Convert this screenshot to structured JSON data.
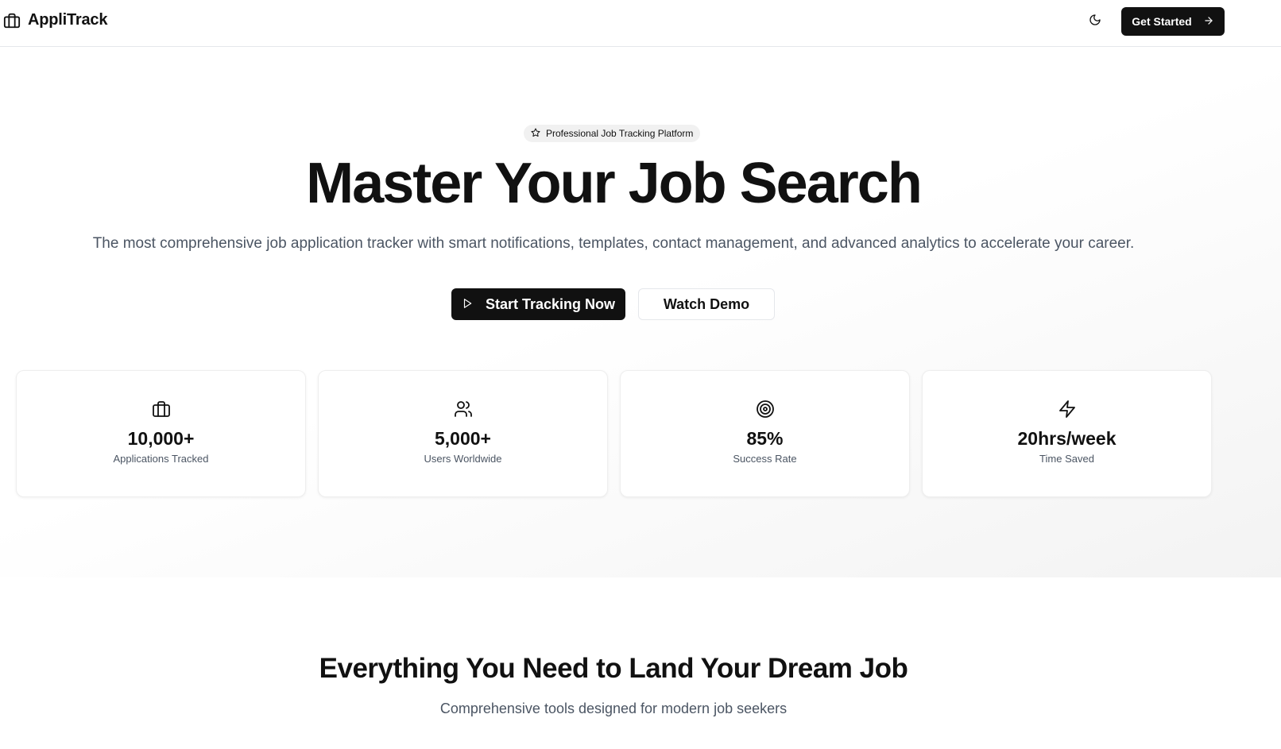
{
  "header": {
    "brand_name": "AppliTrack",
    "brand_icon": "briefcase-icon",
    "theme_icon": "moon-icon",
    "cta_label": "Get Started",
    "cta_icon": "arrow-right-icon"
  },
  "hero": {
    "badge_icon": "star-icon",
    "badge_text": "Professional Job Tracking Platform",
    "title": "Master Your Job Search",
    "subtitle": "The most comprehensive job application tracker with smart notifications, templates, contact management, and advanced analytics to accelerate your career.",
    "primary_button": {
      "label": "Start Tracking Now",
      "icon": "play-icon"
    },
    "secondary_button": {
      "label": "Watch Demo"
    }
  },
  "stats": [
    {
      "icon": "briefcase-icon",
      "value": "10,000+",
      "label": "Applications Tracked"
    },
    {
      "icon": "users-icon",
      "value": "5,000+",
      "label": "Users Worldwide"
    },
    {
      "icon": "target-icon",
      "value": "85%",
      "label": "Success Rate"
    },
    {
      "icon": "zap-icon",
      "value": "20hrs/week",
      "label": "Time Saved"
    }
  ],
  "features": {
    "title": "Everything You Need to Land Your Dream Job",
    "subtitle": "Comprehensive tools designed for modern job seekers"
  },
  "colors": {
    "primary": "#111111",
    "text_muted": "#4b5563",
    "border": "#e5e7eb",
    "badge_bg": "#f1f1f1"
  }
}
